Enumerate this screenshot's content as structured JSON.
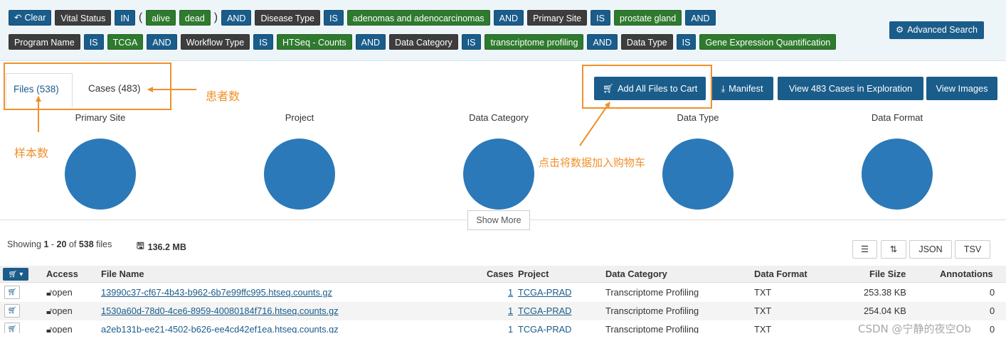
{
  "query": {
    "clear_label": "Clear",
    "row1": [
      "Vital Status",
      "IN",
      "(",
      "alive",
      "dead",
      ")",
      "AND",
      "Disease Type",
      "IS",
      "adenomas and adenocarcinomas",
      "AND",
      "Primary Site",
      "IS",
      "prostate gland",
      "AND"
    ],
    "row2": [
      "Program Name",
      "IS",
      "TCGA",
      "AND",
      "Workflow Type",
      "IS",
      "HTSeq - Counts",
      "AND",
      "Data Category",
      "IS",
      "transcriptome profiling",
      "AND",
      "Data Type",
      "IS",
      "Gene Expression Quantification"
    ],
    "advanced_search_label": "Advanced Search"
  },
  "tabs": {
    "files": "Files (538)",
    "cases": "Cases (483)"
  },
  "actions": {
    "add_all": "Add All Files to Cart",
    "manifest": "Manifest",
    "view_cases": "View 483 Cases in Exploration",
    "view_images": "View Images"
  },
  "summary_charts": {
    "primary_site": "Primary Site",
    "project": "Project",
    "data_category": "Data Category",
    "data_type": "Data Type",
    "data_format": "Data Format",
    "color": "#2b79b8"
  },
  "show_more": "Show More",
  "results": {
    "showing_prefix": "Showing",
    "from": "1",
    "to": "20",
    "of": "of",
    "total": "538",
    "unit": "files",
    "size": "136.2 MB"
  },
  "table_tools": {
    "json": "JSON",
    "tsv": "TSV"
  },
  "table": {
    "headers": {
      "access": "Access",
      "file_name": "File Name",
      "cases": "Cases",
      "project": "Project",
      "data_category": "Data Category",
      "data_format": "Data Format",
      "file_size": "File Size",
      "annotations": "Annotations"
    },
    "rows": [
      {
        "access": "open",
        "file_name": "13990c37-cf67-4b43-b962-6b7e99ffc995.htseq.counts.gz",
        "cases": "1",
        "project": "TCGA-PRAD",
        "data_category": "Transcriptome Profiling",
        "data_format": "TXT",
        "file_size": "253.38 KB",
        "annotations": "0"
      },
      {
        "access": "open",
        "file_name": "1530a60d-78d0-4ce6-8959-40080184f716.htseq.counts.gz",
        "cases": "1",
        "project": "TCGA-PRAD",
        "data_category": "Transcriptome Profiling",
        "data_format": "TXT",
        "file_size": "254.04 KB",
        "annotations": "0"
      },
      {
        "access": "open",
        "file_name": "a2eb131b-ee21-4502-b626-ee4cd42ef1ea.htseq.counts.gz",
        "cases": "1",
        "project": "TCGA-PRAD",
        "data_category": "Transcriptome Profiling",
        "data_format": "TXT",
        "file_size": "",
        "annotations": "0"
      }
    ]
  },
  "annotations": {
    "cases_note": "患者数",
    "samples_note": "样本数",
    "cart_note": "点击将数据加入购物车",
    "color": "#f0902a"
  },
  "watermark": "CSDN @宁静的夜空Ob"
}
